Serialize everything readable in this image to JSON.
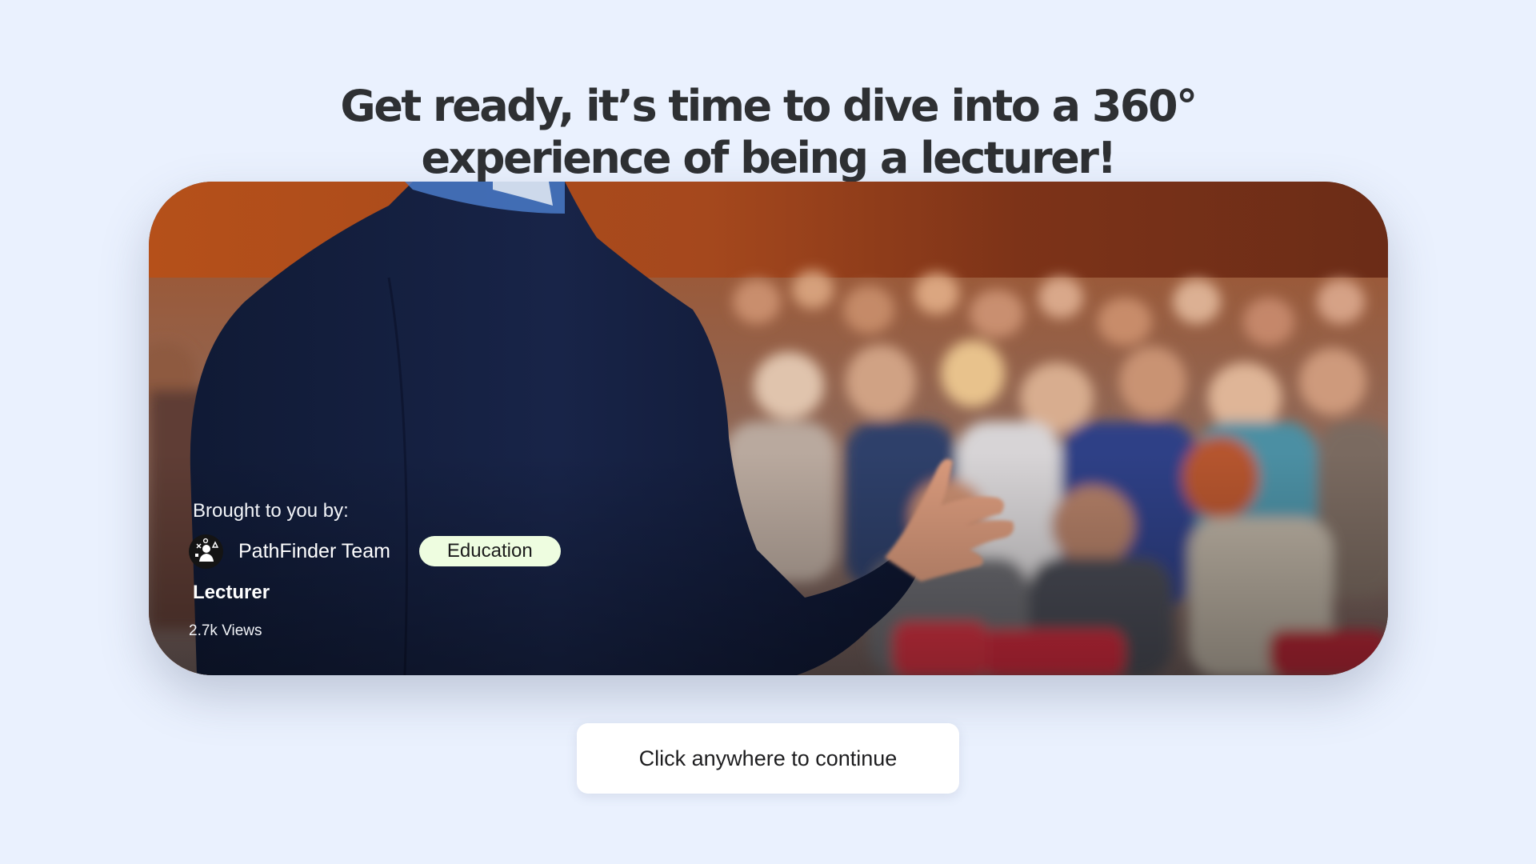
{
  "headline": {
    "line1": "Get ready, it’s time to dive into a 360°",
    "line2": "experience of being a lecturer!"
  },
  "card": {
    "brought_by_label": "Brought to you by:",
    "author": {
      "name": "PathFinder Team",
      "avatar_icon": "team-logo-icon"
    },
    "category_tag": "Education",
    "title": "Lecturer",
    "views": "2.7k Views",
    "image_subject": "lecturer-presenting-to-audience-photo"
  },
  "continue_button": {
    "label": "Click anywhere to continue"
  },
  "colors": {
    "background": "#eaf1fe",
    "headline": "#2e3033",
    "tag_background": "#eefde0",
    "button_background": "#ffffff"
  }
}
